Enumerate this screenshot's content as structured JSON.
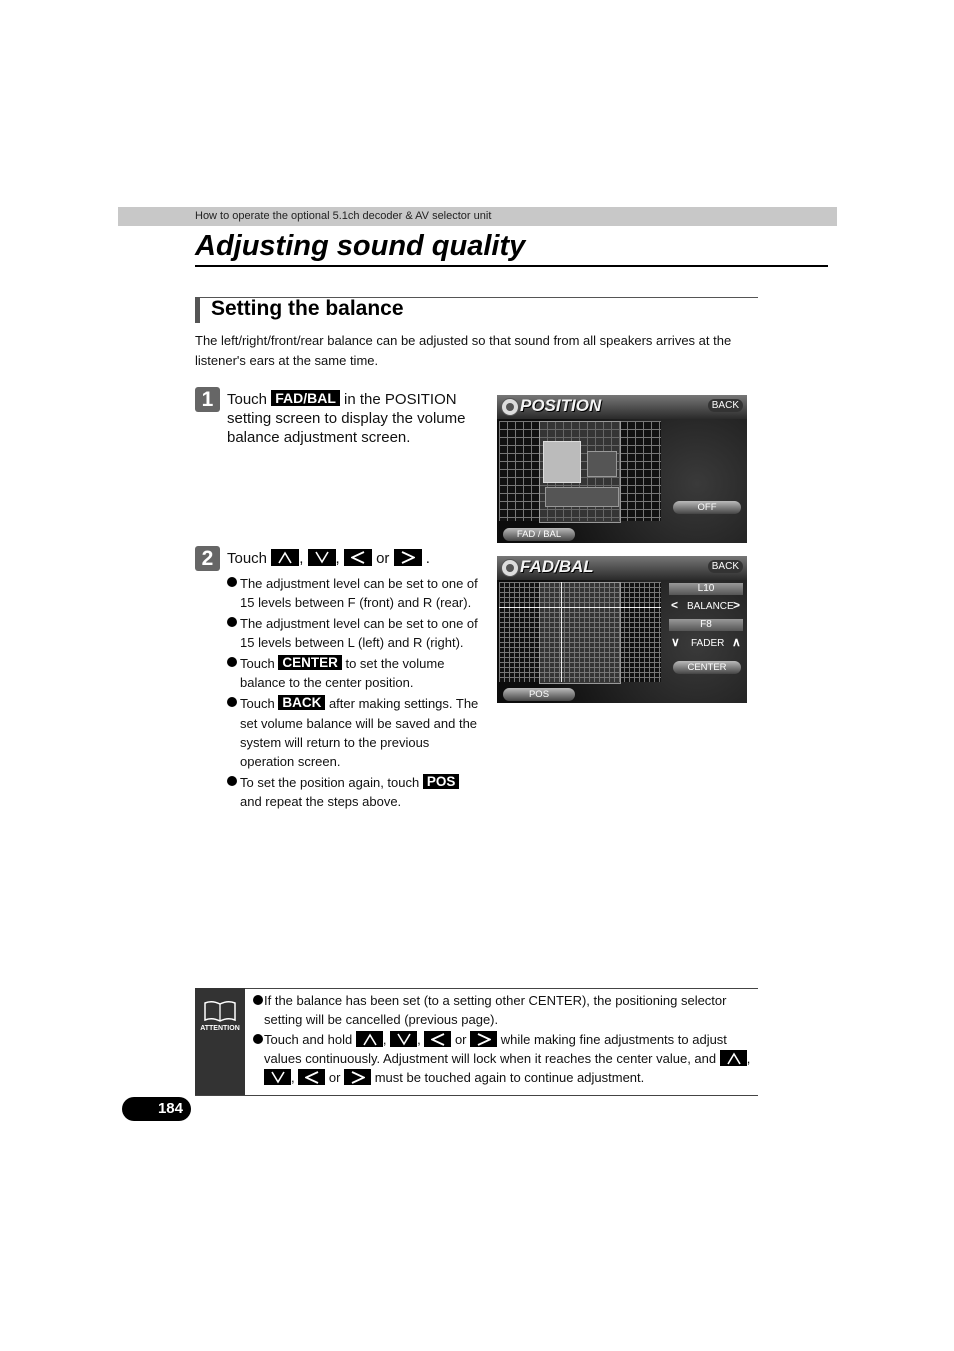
{
  "header": {
    "section_label": "How to operate the optional 5.1ch decoder & AV selector unit"
  },
  "page_title": "Adjusting sound quality",
  "section": {
    "title": "Setting the balance",
    "intro": "The left/right/front/rear balance can be adjusted so that sound from all speakers arrives at the listener's ears at the same time."
  },
  "step1": {
    "number": "1",
    "pre": "Touch",
    "button": "FAD/BAL",
    "post": "in the POSITION",
    "rest": "setting screen to display the volume balance adjustment screen."
  },
  "step2": {
    "number": "2",
    "pre": "Touch",
    "sep1": ",",
    "sep2": ",",
    "or": "or",
    "end": ".",
    "arrows": [
      "up-arrow",
      "down-arrow",
      "left-arrow",
      "right-arrow"
    ],
    "bullets": [
      {
        "text": "The adjustment level can be set to one of 15 levels between F (front) and R (rear)."
      },
      {
        "text": "The adjustment level can be set to one of 15 levels between L (left) and R (right)."
      },
      {
        "pre": "Touch",
        "button": "CENTER",
        "post": "to set the volume balance to the center position."
      },
      {
        "pre": "Touch",
        "button": "BACK",
        "post": "after making settings. The set volume balance will be saved and the system will return to the previous operation screen."
      },
      {
        "pre": "To set the position again, touch",
        "button": "POS",
        "post": "and repeat the steps above."
      }
    ]
  },
  "screen_position": {
    "title": "POSITION",
    "back": "BACK",
    "off": "OFF",
    "fad_bal": "FAD / BAL"
  },
  "screen_fadbal": {
    "title": "FAD/BAL",
    "back": "BACK",
    "balance_value": "L10",
    "balance_label": "BALANCE",
    "fader_value": "F8",
    "fader_label": "FADER",
    "center": "CENTER",
    "pos": "POS"
  },
  "attention": {
    "icon_label": "ATTENTION",
    "item1": "If the balance has been set (to a setting other CENTER), the positioning selector setting will be cancelled (previous page).",
    "item2_pre": "Touch and hold",
    "item2_mid": "while making fine adjustments to adjust values continuously. Adjustment will lock when it reaches the center value, and",
    "item2_post": "must be touched again to continue adjustment.",
    "sep": ",",
    "or": "or"
  },
  "page_number": "184"
}
